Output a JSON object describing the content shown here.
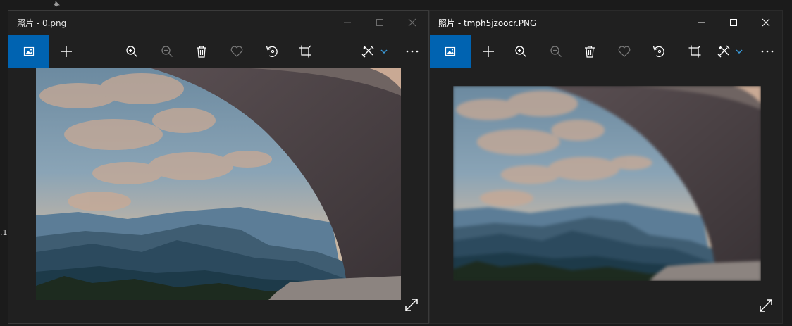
{
  "desktop": {
    "edge_text": ".1"
  },
  "windows": [
    {
      "title": "照片 - 0.png",
      "active": false,
      "toolbar": [
        "view-icon",
        "add-icon",
        "zoom-in-icon",
        "zoom-out-icon",
        "delete-icon",
        "favorite-icon",
        "rotate-icon",
        "crop-icon",
        "edit-icon",
        "more-icon"
      ]
    },
    {
      "title": "照片 - tmph5jzoocr.PNG",
      "active": true,
      "toolbar": [
        "view-icon",
        "add-icon",
        "zoom-in-icon",
        "zoom-out-icon",
        "delete-icon",
        "favorite-icon",
        "rotate-icon",
        "crop-icon",
        "edit-icon",
        "more-icon"
      ]
    }
  ],
  "colors": {
    "accent": "#0063b1",
    "window_bg": "#202020",
    "desktop_bg": "#1b1b1b"
  }
}
